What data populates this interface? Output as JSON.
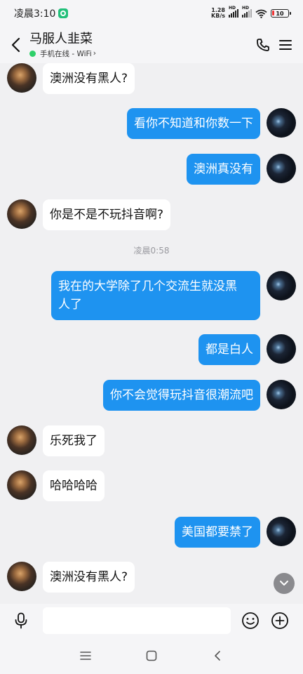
{
  "status_bar": {
    "time": "凌晨3:10",
    "net_speed_value": "1.28",
    "net_speed_unit": "KB/s",
    "signal_1_label": "HD",
    "signal_2_label": "HD",
    "battery": "10"
  },
  "header": {
    "title": "马服人韭菜",
    "presence": "手机在线 - WiFi",
    "presence_chevron": "›"
  },
  "messages": [
    {
      "dir": "in",
      "text": "澳洲没有黑人?"
    },
    {
      "dir": "out",
      "text": "看你不知道和你数一下"
    },
    {
      "dir": "out",
      "text": "澳洲真没有"
    },
    {
      "dir": "in",
      "text": "你是不是不玩抖音啊?"
    },
    {
      "dir": "out",
      "text": "我在的大学除了几个交流生就没黑\n人了"
    },
    {
      "dir": "out",
      "text": "都是白人"
    },
    {
      "dir": "out",
      "text": "你不会觉得玩抖音很潮流吧"
    },
    {
      "dir": "in",
      "text": "乐死我了"
    },
    {
      "dir": "in",
      "text": "哈哈哈哈"
    },
    {
      "dir": "out",
      "text": "美国都要禁了"
    },
    {
      "dir": "in",
      "text": "澳洲没有黑人?"
    }
  ],
  "timestamp": "凌晨0:58",
  "input": {
    "value": "",
    "placeholder": ""
  },
  "colors": {
    "outgoing_bubble": "#1e93f0",
    "incoming_bubble": "#ffffff",
    "background": "#f0f0f2",
    "presence_online": "#2fd06a"
  }
}
